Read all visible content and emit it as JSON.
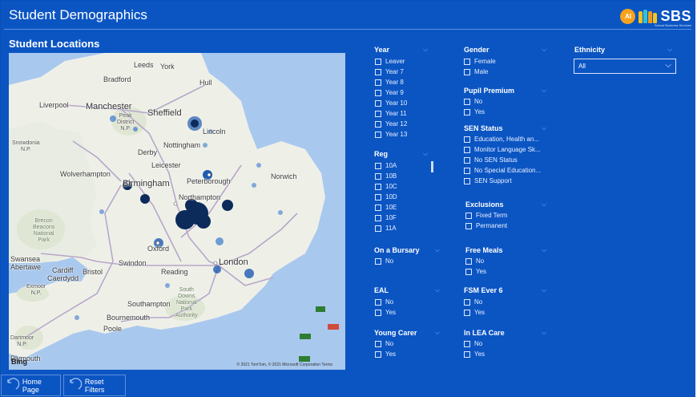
{
  "header": {
    "title": "Student Demographics"
  },
  "logo": {
    "avatar_initials": "AI",
    "brand": "SBS",
    "tagline": "School Business Services"
  },
  "map_section": {
    "title": "Student Locations",
    "attribution": "© 2021 TomTom, © 2021 Microsoft Corporation  Terms",
    "bing": "Bing",
    "places": {
      "leeds": "Leeds",
      "york": "York",
      "bradford": "Bradford",
      "hull": "Hull",
      "liverpool": "Liverpool",
      "manchester": "Manchester",
      "sheffield": "Sheffield",
      "peak": "Peak\nDistrict\nN.P.",
      "snowdonia": "Snowdonia\nN.P.",
      "lincoln": "Lincoln",
      "nottingham": "Nottingham",
      "derby": "Derby",
      "leicester": "Leicester",
      "wolverhampton": "Wolverhampton",
      "birmingham": "Birmingham",
      "peterborough": "Peterborough",
      "norwich": "Norwich",
      "northampton": "Northampton",
      "brecon": "Brecon\nBeacons\nNational\nPark",
      "oxford": "Oxford",
      "swansea": "Swansea",
      "abertawe": "Abertawe",
      "cardiff": "Cardiff",
      "caerdydd": "Caerdydd",
      "bristol": "Bristol",
      "swindon": "Swindon",
      "reading": "Reading",
      "london": "London",
      "exmoor": "Exmoor\nN.P.",
      "south_downs": "South\nDowns\nNational\nPark\nAuthority",
      "southampton": "Southampton",
      "bournemouth": "Bournemouth",
      "poole": "Poole",
      "dartmoor": "Dartmoor\nN.P.",
      "plymouth": "Plymouth"
    }
  },
  "slicers": {
    "year": {
      "title": "Year",
      "options": [
        "Leaver",
        "Year 7",
        "Year 8",
        "Year 9",
        "Year 10",
        "Year 11",
        "Year 12",
        "Year 13"
      ]
    },
    "reg": {
      "title": "Reg",
      "options": [
        "10A",
        "10B",
        "10C",
        "10D",
        "10E",
        "10F",
        "11A"
      ]
    },
    "bursary": {
      "title": "On a Bursary",
      "options": [
        "No"
      ]
    },
    "eal": {
      "title": "EAL",
      "options": [
        "No",
        "Yes"
      ]
    },
    "young_carer": {
      "title": "Young Carer",
      "options": [
        "No",
        "Yes"
      ]
    },
    "gender": {
      "title": "Gender",
      "options": [
        "Female",
        "Male"
      ]
    },
    "pupil_premium": {
      "title": "Pupil Premium",
      "options": [
        "No",
        "Yes"
      ]
    },
    "sen_status": {
      "title": "SEN Status",
      "options": [
        "Education, Health an...",
        "Monitor Language Sk...",
        "No SEN Status",
        "No Special Education...",
        "SEN Support"
      ]
    },
    "exclusions": {
      "title": "Exclusions",
      "options": [
        "Fixed Term",
        "Permanent"
      ]
    },
    "free_meals": {
      "title": "Free Meals",
      "options": [
        "No",
        "Yes"
      ]
    },
    "fsm_ever6": {
      "title": "FSM Ever 6",
      "options": [
        "No",
        "Yes"
      ]
    },
    "lea_care": {
      "title": "In LEA Care",
      "options": [
        "No",
        "Yes"
      ]
    },
    "ethnicity": {
      "title": "Ethnicity",
      "selected": "All"
    }
  },
  "nav": {
    "home": "Home Page",
    "reset": "Reset Filters"
  },
  "colors": {
    "background": "#0b55c3",
    "map_water": "#a9c8ee",
    "map_land": "#eef0e8",
    "bubble": "#0c2a5a"
  }
}
